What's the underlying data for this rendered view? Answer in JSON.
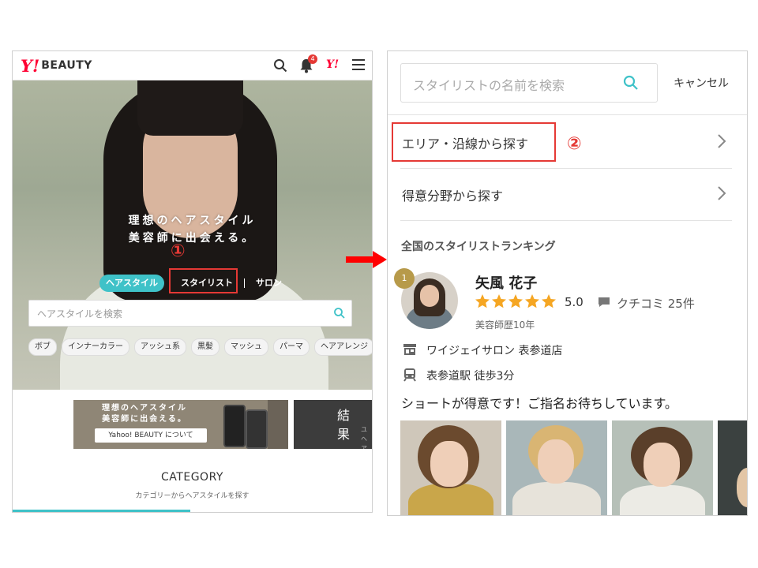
{
  "left": {
    "header": {
      "logo_y": "Y!",
      "logo_text": "BEAUTY",
      "notification_count": "4",
      "yj_logo": "Y!"
    },
    "hero": {
      "tagline_line1": "理想のヘアスタイル",
      "tagline_line2": "美容師に出会える。",
      "tabs": [
        "ヘアスタイル",
        "スタイリスト",
        "サロン"
      ],
      "search_placeholder": "ヘアスタイルを検索",
      "chips": [
        "ボブ",
        "インナーカラー",
        "アッシュ系",
        "黒髪",
        "マッシュ",
        "パーマ",
        "ヘアアレンジ"
      ]
    },
    "banner1": {
      "line1": "理想のヘアスタイル",
      "line2": "美容師に出会える。",
      "button": "Yahoo! BEAUTY について"
    },
    "banner2": {
      "text": "結 果",
      "sub1": "ユ",
      "sub2": "ヘア"
    },
    "category": {
      "title": "CATEGORY",
      "subtitle": "カテゴリーからヘアスタイルを探す"
    }
  },
  "annotations": {
    "step1": "①",
    "step2": "②"
  },
  "right": {
    "search_placeholder": "スタイリストの名前を検索",
    "cancel": "キャンセル",
    "menu": [
      {
        "label": "エリア・沿線から探す"
      },
      {
        "label": "得意分野から探す"
      }
    ],
    "ranking": {
      "title": "全国のスタイリストランキング",
      "rank": "1",
      "name": "矢風 花子",
      "rating": "5.0",
      "stars": 5,
      "review_label": "クチコミ 25件",
      "experience": "美容師歴10年",
      "salon": "ワイジェイサロン 表参道店",
      "station": "表参道駅 徒歩3分",
      "comment": "ショートが得意です！ご指名お待ちしています。"
    }
  },
  "colors": {
    "accent": "#3fc2c8",
    "annotation_red": "#e53935",
    "star": "#f5a623",
    "rank_gold": "#b79a4a"
  }
}
